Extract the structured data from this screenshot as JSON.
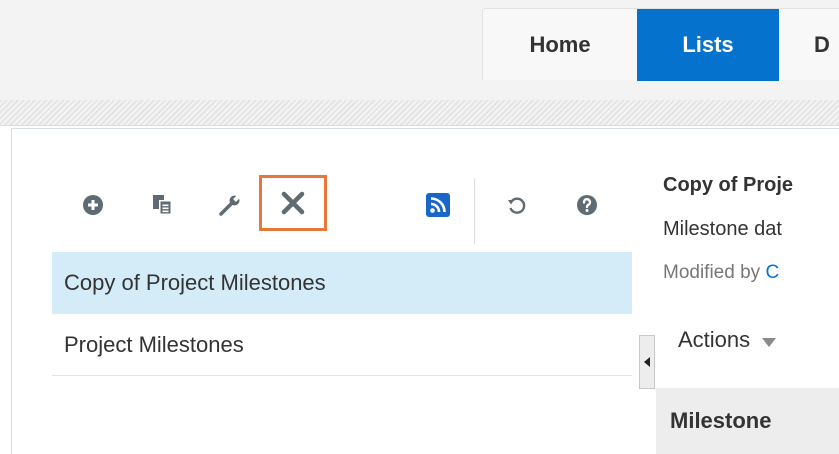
{
  "nav": {
    "tabs": [
      {
        "label": "Home",
        "active": false
      },
      {
        "label": "Lists",
        "active": true
      },
      {
        "label": "D",
        "active": false
      }
    ],
    "active_color": "#0572ce"
  },
  "toolbar": {
    "buttons": [
      {
        "icon": "add-icon"
      },
      {
        "icon": "copy-icon"
      },
      {
        "icon": "wrench-icon"
      },
      {
        "icon": "close-icon",
        "highlighted": true,
        "highlight_color": "#e8773a"
      },
      {
        "icon": "rss-icon",
        "color": "#1a66c8"
      },
      {
        "icon": "refresh-icon"
      },
      {
        "icon": "help-icon"
      }
    ]
  },
  "lists": {
    "items": [
      {
        "label": "Copy of Project Milestones",
        "selected": true
      },
      {
        "label": "Project Milestones",
        "selected": false
      }
    ],
    "selected_color": "#d3ecf8"
  },
  "detail": {
    "title": "Copy of Proje",
    "description": "Milestone dat",
    "modified_by_label": "Modified by",
    "modified_by_user": "C",
    "actions_label": "Actions",
    "column_header": "Milestone"
  }
}
